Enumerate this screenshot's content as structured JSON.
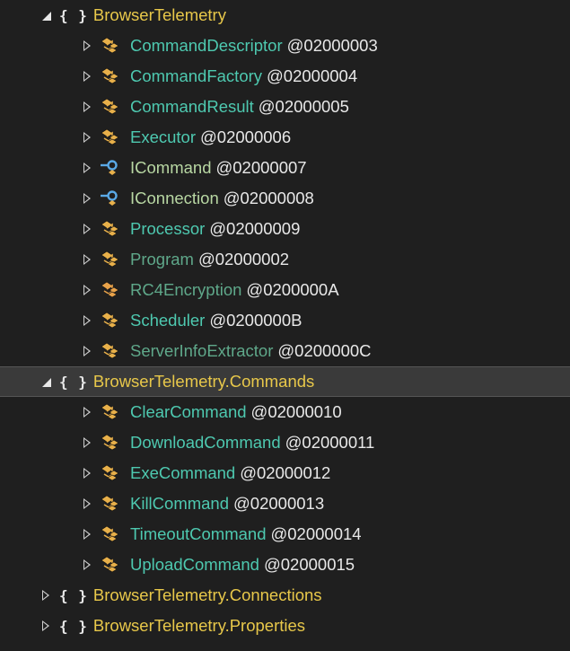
{
  "colors": {
    "background": "#1f1f1f",
    "selected_row": "#3a3a3a",
    "namespace": "#e8c84a",
    "class": "#4ec9b0",
    "interface": "#b8d7a3",
    "internal": "#5fa88a",
    "token": "#e8e8e8"
  },
  "tree": {
    "namespaces": [
      {
        "label": "BrowserTelemetry",
        "icon": "namespace-icon",
        "expanded": true,
        "types": [
          {
            "name": "CommandDescriptor",
            "token": "@02000003",
            "kind": "class",
            "icon": "class-icon"
          },
          {
            "name": "CommandFactory",
            "token": "@02000004",
            "kind": "class",
            "icon": "class-icon"
          },
          {
            "name": "CommandResult",
            "token": "@02000005",
            "kind": "class",
            "icon": "class-icon"
          },
          {
            "name": "Executor",
            "token": "@02000006",
            "kind": "class",
            "icon": "class-icon"
          },
          {
            "name": "ICommand",
            "token": "@02000007",
            "kind": "interface",
            "icon": "interface-icon"
          },
          {
            "name": "IConnection",
            "token": "@02000008",
            "kind": "interface",
            "icon": "interface-icon"
          },
          {
            "name": "Processor",
            "token": "@02000009",
            "kind": "class",
            "icon": "class-icon"
          },
          {
            "name": "Program",
            "token": "@02000002",
            "kind": "internal",
            "icon": "class-icon"
          },
          {
            "name": "RC4Encryption",
            "token": "@0200000A",
            "kind": "internal",
            "icon": "static-class-icon"
          },
          {
            "name": "Scheduler",
            "token": "@0200000B",
            "kind": "class",
            "icon": "class-icon"
          },
          {
            "name": "ServerInfoExtractor",
            "token": "@0200000C",
            "kind": "internal",
            "icon": "class-icon"
          }
        ]
      },
      {
        "label": "BrowserTelemetry.Commands",
        "icon": "namespace-icon",
        "expanded": true,
        "selected": true,
        "types": [
          {
            "name": "ClearCommand",
            "token": "@02000010",
            "kind": "class",
            "icon": "class-icon"
          },
          {
            "name": "DownloadCommand",
            "token": "@02000011",
            "kind": "class",
            "icon": "class-icon"
          },
          {
            "name": "ExeCommand",
            "token": "@02000012",
            "kind": "class",
            "icon": "class-icon"
          },
          {
            "name": "KillCommand",
            "token": "@02000013",
            "kind": "class",
            "icon": "class-icon"
          },
          {
            "name": "TimeoutCommand",
            "token": "@02000014",
            "kind": "class",
            "icon": "class-icon"
          },
          {
            "name": "UploadCommand",
            "token": "@02000015",
            "kind": "class",
            "icon": "class-icon"
          }
        ]
      },
      {
        "label": "BrowserTelemetry.Connections",
        "icon": "namespace-icon",
        "expanded": false,
        "types": []
      },
      {
        "label": "BrowserTelemetry.Properties",
        "icon": "namespace-icon",
        "expanded": false,
        "types": []
      }
    ]
  }
}
